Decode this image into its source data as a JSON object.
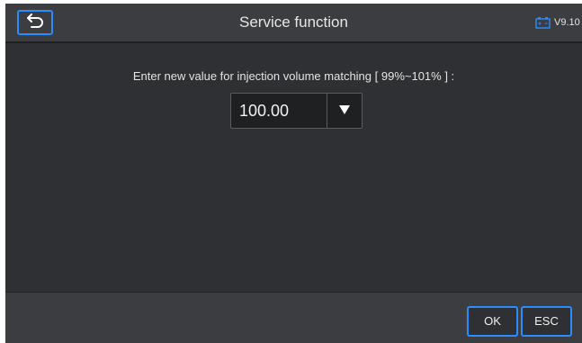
{
  "header": {
    "title": "Service function",
    "version": "V9.10",
    "back_icon": "back-arrow-icon",
    "battery_icon": "battery-icon"
  },
  "main": {
    "prompt": "Enter new value for injection volume matching [ 99%~101% ] :",
    "value": "100.00",
    "dropdown_icon": "triangle-down-icon"
  },
  "footer": {
    "ok_label": "OK",
    "esc_label": "ESC"
  },
  "colors": {
    "accent": "#2a8cff",
    "background": "#2f3033",
    "bar": "#3c3d40"
  }
}
